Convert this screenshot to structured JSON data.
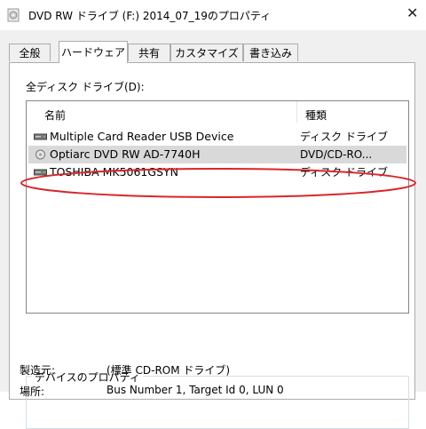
{
  "window": {
    "title": "DVD RW ドライブ (F:) 2014_07_19のプロパティ",
    "close_glyph": "✕"
  },
  "tabs": [
    {
      "label": "全般",
      "active": false
    },
    {
      "label": "ハードウェア",
      "active": true
    },
    {
      "label": "共有",
      "active": false
    },
    {
      "label": "カスタマイズ",
      "active": false
    },
    {
      "label": "書き込み",
      "active": false
    }
  ],
  "drives_section": {
    "label": "全ディスク ドライブ(D):",
    "columns": [
      "名前",
      "種類"
    ],
    "rows": [
      {
        "name": "Multiple Card  Reader USB Device",
        "type": "ディスク ドライブ",
        "icon": "disk-drive-icon",
        "selected": false
      },
      {
        "name": "Optiarc DVD RW AD-7740H",
        "type": "DVD/CD-RO...",
        "icon": "optical-drive-icon",
        "selected": true
      },
      {
        "name": "TOSHIBA MK5061GSYN",
        "type": "ディスク ドライブ",
        "icon": "disk-drive-icon",
        "selected": false
      }
    ]
  },
  "device_properties": {
    "title": "デバイスのプロパティ",
    "manufacturer_label": "製造元:",
    "manufacturer_value": "(標準 CD-ROM ドライブ)",
    "location_label": "場所:",
    "location_value": "Bus Number 1, Target Id 0, LUN 0"
  },
  "colors": {
    "annotation_ellipse": "#d9262b",
    "selected_row": "#d9d9d9"
  }
}
